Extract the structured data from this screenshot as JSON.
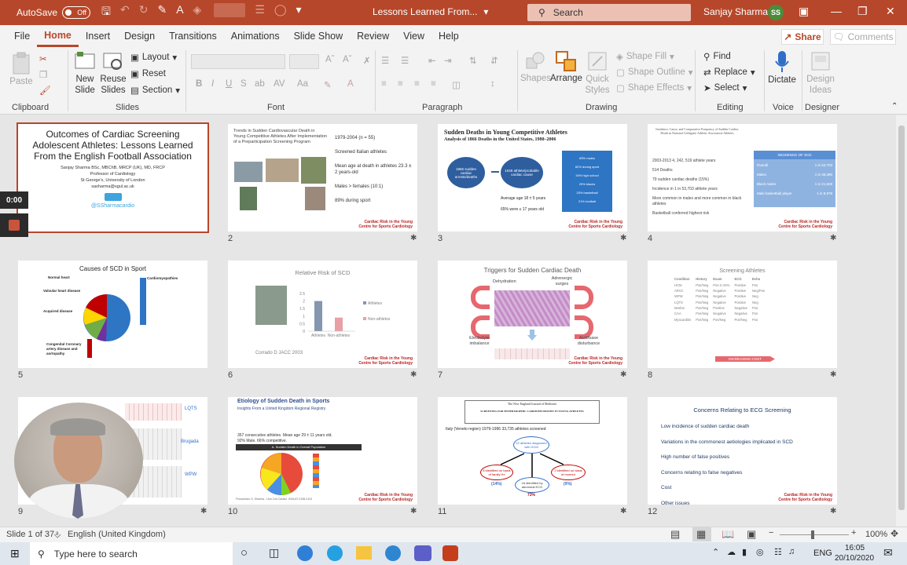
{
  "titlebar": {
    "autosave_label": "AutoSave",
    "autosave_state": "Off",
    "doc_title": "Lessons Learned From...",
    "search_placeholder": "Search",
    "user_name": "Sanjay Sharma",
    "user_initials": "SS"
  },
  "menu": {
    "items": [
      "File",
      "Home",
      "Insert",
      "Design",
      "Transitions",
      "Animations",
      "Slide Show",
      "Review",
      "View",
      "Help"
    ],
    "active": "Home",
    "share": "Share",
    "comments": "Comments"
  },
  "ribbon": {
    "clipboard": {
      "label": "Clipboard",
      "paste": "Paste"
    },
    "slides": {
      "label": "Slides",
      "new_slide": "New Slide",
      "reuse_slides": "Reuse Slides",
      "layout": "Layout",
      "reset": "Reset",
      "section": "Section"
    },
    "font": {
      "label": "Font"
    },
    "paragraph": {
      "label": "Paragraph"
    },
    "drawing": {
      "label": "Drawing",
      "shapes": "Shapes",
      "arrange": "Arrange",
      "quick_styles": "Quick Styles",
      "shape_fill": "Shape Fill",
      "shape_outline": "Shape Outline",
      "shape_effects": "Shape Effects"
    },
    "editing": {
      "label": "Editing",
      "find": "Find",
      "replace": "Replace",
      "select": "Select"
    },
    "voice": {
      "label": "Voice",
      "dictate": "Dictate"
    },
    "designer": {
      "label": "Designer",
      "design_ideas": "Design Ideas"
    }
  },
  "slides": [
    {
      "num": "1",
      "title": "Outcomes of Cardiac Screening Adolescent Athletes: Lessons Learned From the English Football Association",
      "lines": [
        "Sanjay Sharma BSc, MBChB, MRCP (UK), MD, FRCP",
        "Professor of Cardiology",
        "St George's, University of London",
        "sasharma@sgul.ac.uk"
      ],
      "twitter": "@SSharmacardio"
    },
    {
      "num": "2",
      "title": "Trends in Sudden Cardiovascular Death in Young Competitive Athletes After Implementation of a Preparticipation Screening Program",
      "bullets": [
        "1979-2004 (n = 55)",
        "Screened Italian athletes",
        "Mean age at death in athletes 23.3 ± 2 years-old",
        "Males > females (10:1)",
        "89% during sport"
      ]
    },
    {
      "num": "3",
      "title": "Sudden Deaths in Young Competitive Athletes",
      "subtitle": "Analysis of 1866 Deaths in the United States, 1980–2006",
      "circle1": "1866 sudden cardiac arrests/deaths",
      "circle2": "1049 athlete/probable cardiac cause",
      "boxes": [
        "89% males",
        "82% during sport",
        "34% high school",
        "29% blacks",
        "33% basketball",
        "21% football"
      ],
      "age_line": "Average age 18 ± 5 years",
      "pct_line": "65% were ≤ 17 years old"
    },
    {
      "num": "4",
      "title": "Incidence, Cause, and Comparative Frequency of Sudden Cardiac Death in National Collegiate Athletic Association Athletes",
      "lines": [
        "2003-2013      4, 242, 519 athlete years",
        "514 Deaths",
        "79 sudden cardiac deaths (15%)",
        "Incidence in 1 in 53,703 athlete years",
        "More common in males and more common in black athletes",
        "Basketball conferred highest risk"
      ],
      "table_head": "INCIDENCE OF SCD",
      "table_rows": [
        [
          "Overall",
          "1 in 53,703"
        ],
        [
          "Males",
          "1 in 38,390"
        ],
        [
          "Black males",
          "1 in 21,628"
        ],
        [
          "Male basketball player",
          "1 in 8,978"
        ]
      ]
    },
    {
      "num": "5",
      "title": "Causes of SCD in Sport",
      "labels": [
        "Normal heart",
        "Cardiomyopathies",
        "Valvular heart disease",
        "Acquired disease",
        "Congenital Coronary artery disease and aortopathy"
      ]
    },
    {
      "num": "6",
      "title": "Relative Risk of SCD",
      "citation": "Corrado D JACC 2003",
      "chart": {
        "categories": [
          "Athletes",
          "Non-athletes"
        ],
        "values": [
          2.0,
          0.9
        ],
        "yticks": [
          "2.5",
          "2",
          "1.5",
          "1",
          "0.5",
          "0"
        ]
      }
    },
    {
      "num": "7",
      "title": "Triggers for Sudden Cardiac Death",
      "labels": [
        "Dehydration",
        "Adrenergic surges",
        "Electrolyte imbalance",
        "Acid/base disturbance"
      ]
    },
    {
      "num": "8",
      "title": "Screening Athletes",
      "headers": [
        "Condition",
        "History",
        "Exam",
        "ECG",
        "Echo"
      ],
      "rows": [
        [
          "HCM",
          "Pos/Neg",
          "Pos in 25%",
          "Positive",
          "Pos"
        ],
        [
          "ARVC",
          "Pos/Neg",
          "Negative",
          "Positive",
          "Neg/Pos"
        ],
        [
          "WPW",
          "Pos/Neg",
          "Negative",
          "Positive",
          "Neg"
        ],
        [
          "LQTS",
          "Pos/Neg",
          "Negative",
          "Positive",
          "Neg"
        ],
        [
          "Marfan",
          "Pos/Neg",
          "Positive",
          "Negative",
          "Pos"
        ],
        [
          "CAA",
          "Pos/Neg",
          "Negative",
          "Negative",
          "Pos"
        ],
        [
          "Myocarditis",
          "Pos/Neg",
          "Pos/Neg",
          "Pos/Neg",
          "Pos"
        ]
      ],
      "bar_label": "INCREASING COST"
    },
    {
      "num": "9",
      "labels": [
        "LQTS",
        "Brugada",
        "WPW"
      ]
    },
    {
      "num": "10",
      "title": "Etiology of Sudden Death in Sports",
      "subtitle": "Insights From a United Kingdom Regional Registry",
      "stats": "357 consecutive athletes.  Mean age 29 ± 11 years old. 92% Male.  66% competitive.",
      "banner": "A. Sudden Death in Overall Population",
      "citation": "Finocchiaro G, Sharma. J Am Coll Cardiol. 2016;67:2108-2115"
    },
    {
      "num": "11",
      "journal": "The New England Journal of Medicine",
      "header": "SCREENING FOR HYPERTROPHIC CARDIOMYOPATHY IN YOUNG ATHLETES",
      "line": "Italy (Veneto region)   1979-1996     33,735 athletes screened",
      "top_node": "22 athletes diagnosed with HCM",
      "left_node": "8 identified on basis of family Hx",
      "left_pct": "(14%)",
      "mid_node": "16 identified by abnormal ECG",
      "mid_pct": "73%",
      "right_node": "2 identified on basis of murmur",
      "right_pct": "(9%)"
    },
    {
      "num": "12",
      "title": "Concerns Relating to ECG Screening",
      "items": [
        "Low incidence of sudden cardiac death",
        "Variations in the commonest aetiologies implicated in SCD",
        "High number of false positives",
        "Concerns relating to false negatives",
        "Cost",
        "Other issues"
      ]
    }
  ],
  "logo_text": {
    "line1": "Cardiac Risk in the Young",
    "line2": "Centre for Sports Cardiology"
  },
  "recording": {
    "timer": "0:00"
  },
  "status": {
    "slide_info": "Slide 1 of 37",
    "language": "English (United Kingdom)",
    "zoom": "100%"
  },
  "taskbar": {
    "search_placeholder": "Type here to search",
    "lang": "ENG",
    "time": "16:05",
    "date": "20/10/2020"
  }
}
